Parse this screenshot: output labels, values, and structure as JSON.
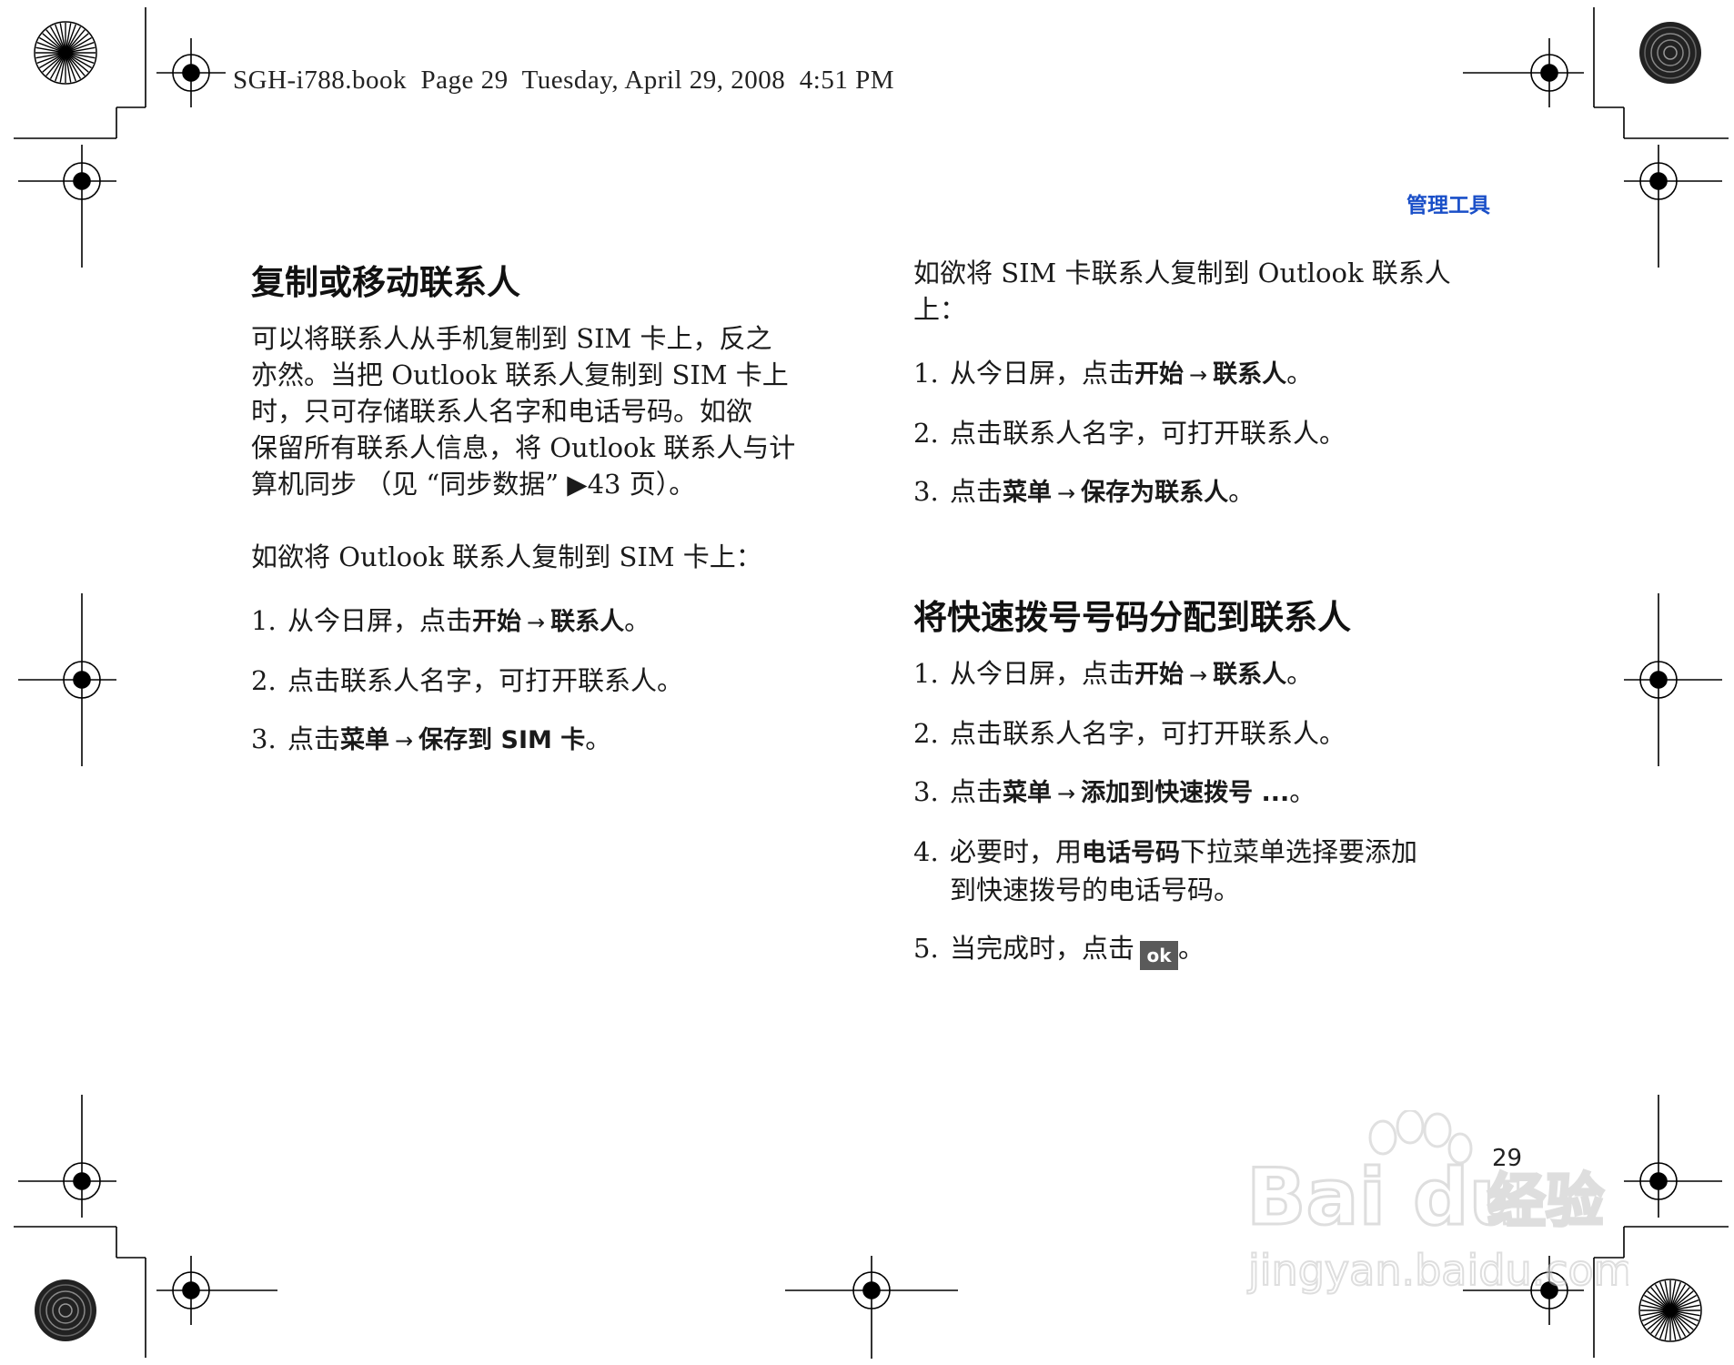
{
  "header": {
    "file_line": "SGH-i788.book  Page 29  Tuesday, April 29, 2008  4:51 PM",
    "section_label": "管理工具"
  },
  "left": {
    "heading": "复制或移动联系人",
    "intro_lines": [
      "可以将联系人从手机复制到 SIM 卡上，反之",
      "亦然。当把 Outlook 联系人复制到 SIM 卡上",
      "时，只可存储联系人名字和电话号码。如欲",
      "保留所有联系人信息，将 Outlook 联系人与计",
      "算机同步 （见 “同步数据” ▶43 页）。"
    ],
    "lead": "如欲将 Outlook 联系人复制到 SIM 卡上：",
    "steps": [
      {
        "num": "1.",
        "text": "从今日屏，点击",
        "b1": "开始",
        "arrow": "→",
        "b2": "联系人",
        "end": "。"
      },
      {
        "num": "2.",
        "text": "点击联系人名字，可打开联系人。"
      },
      {
        "num": "3.",
        "text": "点击",
        "b1": "菜单",
        "arrow": "→",
        "b2": "保存到 SIM 卡",
        "end": "。"
      }
    ]
  },
  "right": {
    "lead_lines": [
      "如欲将 SIM 卡联系人复制到 Outlook 联系人",
      "上："
    ],
    "steps": [
      {
        "num": "1.",
        "text": "从今日屏，点击",
        "b1": "开始",
        "arrow": "→",
        "b2": "联系人",
        "end": "。"
      },
      {
        "num": "2.",
        "text": "点击联系人名字，可打开联系人。"
      },
      {
        "num": "3.",
        "text": "点击",
        "b1": "菜单",
        "arrow": "→",
        "b2": "保存为联系人",
        "end": "。"
      }
    ],
    "heading2": "将快速拨号号码分配到联系人",
    "steps2": [
      {
        "num": "1.",
        "text": "从今日屏，点击",
        "b1": "开始",
        "arrow": "→",
        "b2": "联系人",
        "end": "。"
      },
      {
        "num": "2.",
        "text": "点击联系人名字，可打开联系人。"
      },
      {
        "num": "3.",
        "text": "点击",
        "b1": "菜单",
        "arrow": "→",
        "b2": "添加到快速拨号 ...",
        "end": "。"
      },
      {
        "num": "4.",
        "pre": "必要时，用",
        "b1": "电话号码",
        "post1": "下拉菜单选择要添加",
        "post2": "到快速拨号的电话号码。"
      },
      {
        "num": "5.",
        "pre": "当完成时，点击",
        "icon": "ok",
        "end": "。"
      }
    ]
  },
  "footer": {
    "page_number": "29",
    "watermark_brand": "Bai du 经验",
    "watermark_url": "jingyan.baidu.com"
  }
}
